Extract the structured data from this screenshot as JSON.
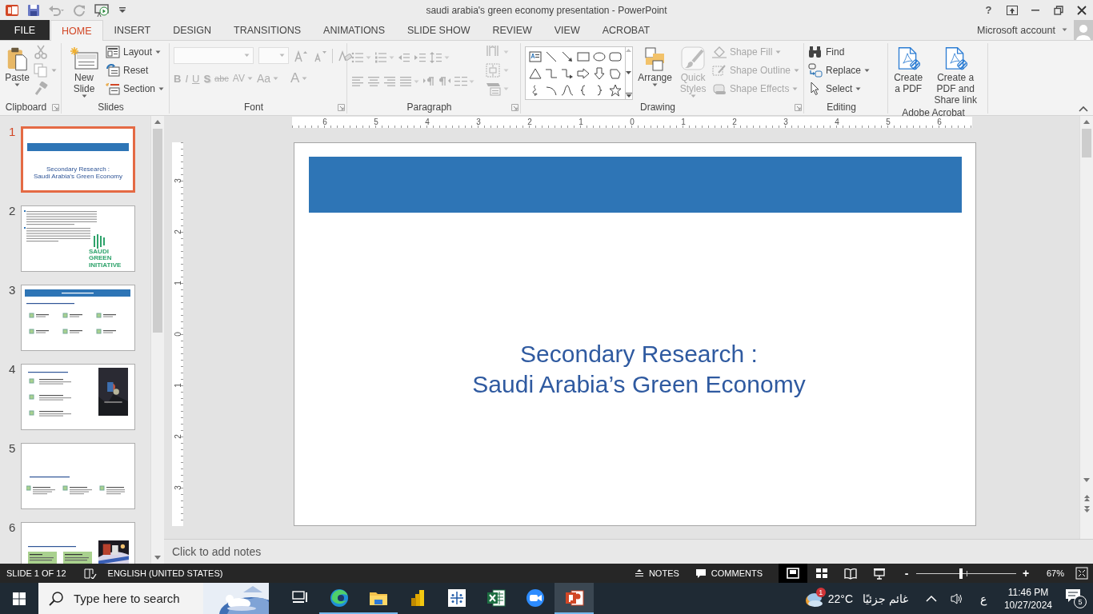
{
  "window": {
    "title": "saudi arabia's green economy presentation - PowerPoint",
    "help": "?",
    "account": "Microsoft account"
  },
  "tabs": [
    {
      "label": "FILE",
      "kind": "backstage",
      "selected": false
    },
    {
      "label": "HOME",
      "kind": "tab",
      "selected": true
    },
    {
      "label": "INSERT",
      "kind": "tab",
      "selected": false
    },
    {
      "label": "DESIGN",
      "kind": "tab",
      "selected": false
    },
    {
      "label": "TRANSITIONS",
      "kind": "tab",
      "selected": false
    },
    {
      "label": "ANIMATIONS",
      "kind": "tab",
      "selected": false
    },
    {
      "label": "SLIDE SHOW",
      "kind": "tab",
      "selected": false
    },
    {
      "label": "REVIEW",
      "kind": "tab",
      "selected": false
    },
    {
      "label": "VIEW",
      "kind": "tab",
      "selected": false
    },
    {
      "label": "ACROBAT",
      "kind": "tab",
      "selected": false
    }
  ],
  "ribbon": {
    "groups": [
      {
        "kind": "clipboard",
        "label": "Clipboard",
        "launcher": true,
        "paste": {
          "label": "Paste"
        },
        "tools": [
          {
            "disabled": true
          },
          {
            "disabled": true
          },
          {
            "disabled": true
          }
        ]
      },
      {
        "kind": "slides",
        "label": "Slides",
        "launcher": false,
        "new_slide": {
          "label": "New Slide"
        },
        "items": [
          {
            "label": "Layout",
            "dropdown": true
          },
          {
            "label": "Reset",
            "dropdown": false
          },
          {
            "label": "Section",
            "dropdown": true
          }
        ]
      },
      {
        "kind": "font",
        "label": "Font",
        "launcher": true,
        "disabled": true,
        "buttons": [
          "B",
          "I",
          "U",
          "S",
          "abc",
          "AV",
          "Aa",
          "A"
        ]
      },
      {
        "kind": "paragraph",
        "label": "Paragraph",
        "launcher": true,
        "disabled": true
      },
      {
        "kind": "drawing",
        "label": "Drawing",
        "launcher": true,
        "items": [
          {
            "label": "Arrange",
            "disabled": false
          },
          {
            "label": "Quick Styles",
            "disabled": true
          }
        ],
        "shape_items": [
          {
            "label": "Shape Fill",
            "disabled": true
          },
          {
            "label": "Shape Outline",
            "disabled": true
          },
          {
            "label": "Shape Effects",
            "disabled": true
          }
        ]
      },
      {
        "kind": "editing",
        "label": "Editing",
        "launcher": false,
        "items": [
          {
            "label": "Find",
            "dropdown": false
          },
          {
            "label": "Replace",
            "dropdown": true
          },
          {
            "label": "Select",
            "dropdown": true
          }
        ]
      },
      {
        "kind": "acrobat",
        "label": "Adobe Acrobat",
        "launcher": false,
        "items": [
          {
            "label": "Create a PDF"
          },
          {
            "label": "Create a PDF and Share link"
          }
        ]
      }
    ]
  },
  "slides": [
    {
      "number": "1",
      "selected": true,
      "kind": "title",
      "title": [
        "Secondary Research :",
        "Saudi Arabia’s Green Economy"
      ]
    },
    {
      "number": "2",
      "selected": false,
      "kind": "text",
      "logo": [
        "SAUDI",
        "GREEN",
        "INITIATIVE"
      ]
    },
    {
      "number": "3",
      "selected": false,
      "kind": "grid"
    },
    {
      "number": "4",
      "selected": false,
      "kind": "list_image"
    },
    {
      "number": "5",
      "selected": false,
      "kind": "columns"
    },
    {
      "number": "6",
      "selected": false,
      "kind": "cards"
    }
  ],
  "editor": {
    "hruler": [
      "6",
      "5",
      "4",
      "3",
      "2",
      "1",
      "0",
      "1",
      "2",
      "3",
      "4",
      "5",
      "6"
    ],
    "vruler": [
      "3",
      "2",
      "1",
      "0",
      "1",
      "2",
      "3"
    ],
    "slide": {
      "title": [
        "Secondary Research :",
        "Saudi Arabia’s Green Economy"
      ]
    },
    "notes": {
      "placeholder": "Click to add notes"
    }
  },
  "status_bar": {
    "slide_position": "SLIDE 1 OF 12",
    "language": "ENGLISH (UNITED STATES)",
    "notes": "NOTES",
    "comments": "COMMENTS",
    "views": [
      {
        "kind": "normal",
        "selected": true
      },
      {
        "kind": "sorter",
        "selected": false
      },
      {
        "kind": "reading",
        "selected": false
      },
      {
        "kind": "slideshow",
        "selected": false
      }
    ],
    "zoom_out": "-",
    "zoom_in": "+",
    "zoom": {
      "level": 0.45
    },
    "zoom_percent": "67%"
  },
  "taskbar": {
    "search": {
      "placeholder": "Type here to search"
    },
    "apps": [
      {
        "kind": "task_view",
        "running": false,
        "active": false
      },
      {
        "kind": "browser",
        "running": true,
        "active": false
      },
      {
        "kind": "folder",
        "running": true,
        "active": false
      },
      {
        "kind": "bars",
        "running": false,
        "active": false
      },
      {
        "kind": "grid",
        "running": false,
        "active": false
      },
      {
        "kind": "spreadsheet",
        "running": false,
        "active": false
      },
      {
        "kind": "video",
        "running": false,
        "active": false
      },
      {
        "kind": "slides",
        "running": true,
        "active": true
      }
    ],
    "weather": {
      "temperature": "22°C",
      "condition": "غائم جزئيًا",
      "badge": "1"
    },
    "input_language": "ع",
    "time": "11:46 PM",
    "date": "10/27/2024",
    "notifications": "5"
  }
}
